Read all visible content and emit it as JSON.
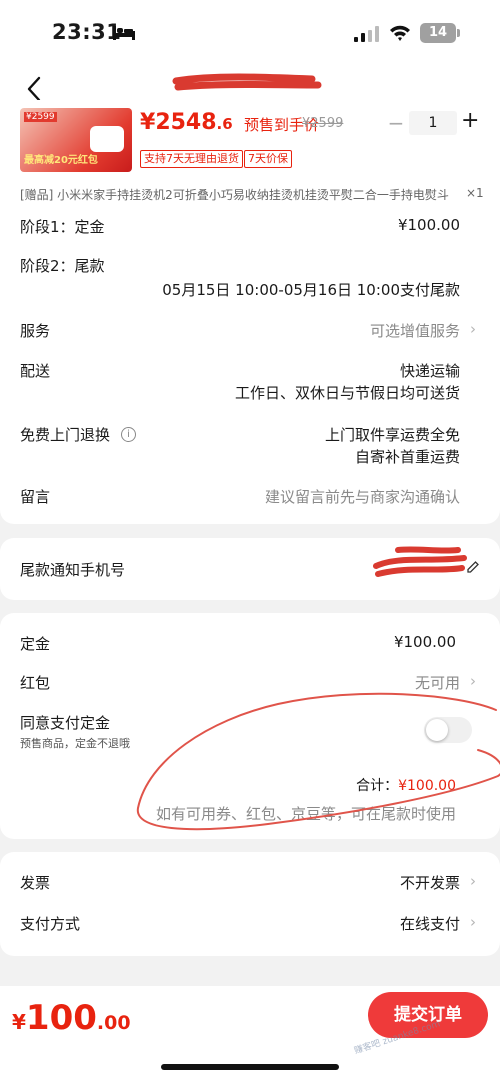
{
  "status_bar": {
    "time": "23:31",
    "battery": "14"
  },
  "product": {
    "price_symbol": "¥",
    "price_int": "2548",
    "price_dec": ".6",
    "presale_label": "预售到手价",
    "original_price": "¥2599",
    "quantity": "1",
    "badges": [
      "支持7天无理由退货",
      "7天价保"
    ],
    "image_tag": "¥2599",
    "image_promo": "最高减20元红包"
  },
  "gift": {
    "text": "[赠品] 小米米家手持挂烫机2可折叠小巧易收纳挂烫机挂烫平熨二合一手持电熨斗",
    "qty": "×1"
  },
  "stages": {
    "stage1_label": "阶段1：定金",
    "stage1_value": "¥100.00",
    "stage2_label": "阶段2：尾款",
    "stage2_value": "05月15日 10:00-05月16日 10:00支付尾款"
  },
  "rows": {
    "service_label": "服务",
    "service_value": "可选增值服务",
    "delivery_label": "配送",
    "delivery_line1": "快递运输",
    "delivery_line2": "工作日、双休日与节假日均可送货",
    "return_label": "免费上门退换",
    "return_line1": "上门取件享运费全免",
    "return_line2": "自寄补首重运费",
    "message_label": "留言",
    "message_placeholder": "建议留言前先与商家沟通确认"
  },
  "phone": {
    "label": "尾款通知手机号"
  },
  "payment": {
    "deposit_label": "定金",
    "deposit_value": "¥100.00",
    "redpacket_label": "红包",
    "redpacket_value": "无可用",
    "agree_label": "同意支付定金",
    "agree_note": "预售商品，定金不退哦",
    "total_label": "合计：",
    "total_value": "¥100.00",
    "hint": "如有可用券、红包、京豆等，可在尾款时使用"
  },
  "invoice": {
    "invoice_label": "发票",
    "invoice_value": "不开发票",
    "method_label": "支付方式",
    "method_value": "在线支付"
  },
  "bottom": {
    "symbol": "¥",
    "amount_int": "100",
    "amount_dec": ".00",
    "submit_label": "提交订单",
    "watermark": "赚客吧 zuanke8.com"
  },
  "colors": {
    "accent": "#e8230f",
    "button": "#ef3a3a"
  }
}
